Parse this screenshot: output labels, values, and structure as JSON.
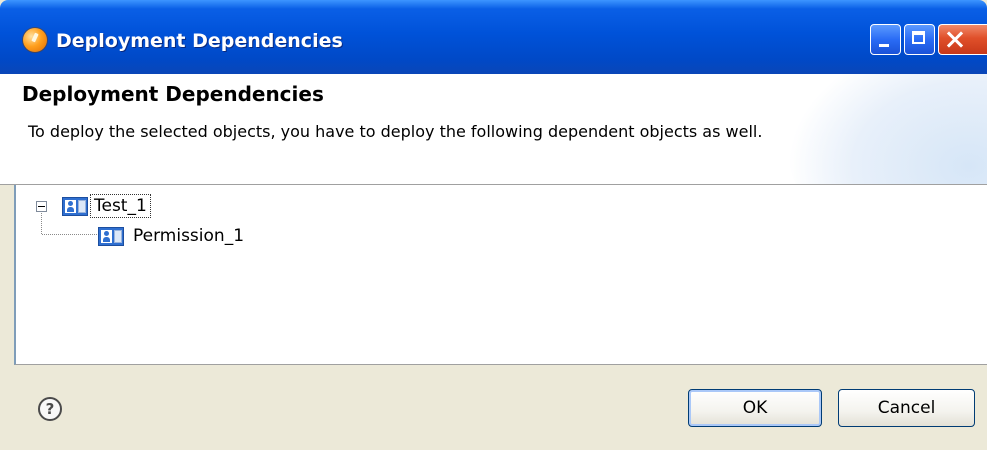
{
  "window": {
    "title": "Deployment Dependencies",
    "controls": [
      "minimize",
      "maximize",
      "close"
    ]
  },
  "header": {
    "title": "Deployment Dependencies",
    "description": "To deploy the selected objects, you have to deploy the following dependent objects as well."
  },
  "tree": {
    "root": {
      "label": "Test_1",
      "icon": "role-icon",
      "expanded": true,
      "children": [
        {
          "label": "Permission_1",
          "icon": "role-icon"
        }
      ]
    }
  },
  "footer": {
    "help_glyph": "?",
    "ok_label": "OK",
    "cancel_label": "Cancel"
  },
  "colors": {
    "titlebar": "#0052d9",
    "close_button": "#e0502a",
    "dialog_background": "#ece9d8"
  }
}
